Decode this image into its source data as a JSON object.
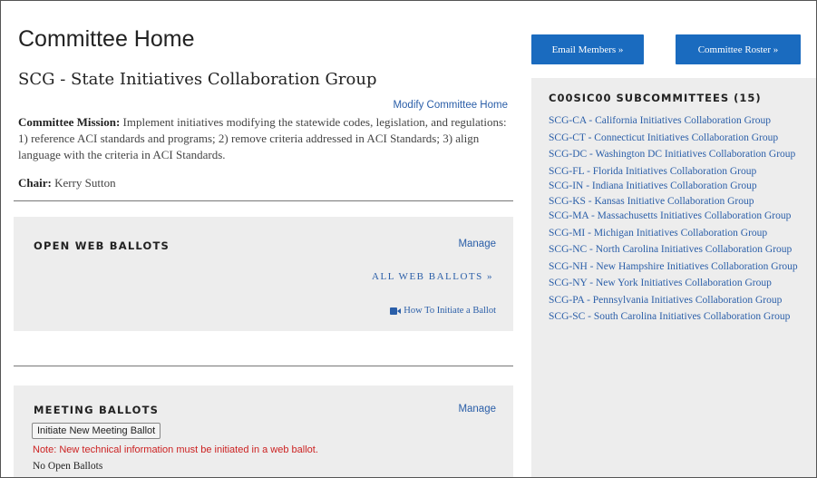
{
  "header": {
    "title": "Committee Home"
  },
  "committee": {
    "name": "SCG - State Initiatives Collaboration Group",
    "modify_link": "Modify Committee Home",
    "mission_label": "Committee Mission:",
    "mission_text": " Implement initiatives modifying the statewide codes, legislation, and regulations: 1) reference ACI standards and programs; 2) remove criteria addressed in ACI Standards; 3) align language with the criteria in ACI Standards.",
    "chair_label": "Chair:",
    "chair_name": " Kerry Sutton"
  },
  "web_ballots": {
    "heading": "OPEN WEB BALLOTS",
    "manage": "Manage",
    "all_link": "ALL WEB BALLOTS »",
    "howto": "How To Initiate a Ballot",
    "howto_icon": "video-icon"
  },
  "meeting_ballots": {
    "heading": "MEETING BALLOTS",
    "manage": "Manage",
    "initiate_button": "Initiate New Meeting Ballot",
    "note": "Note: New technical information must be initiated in a web ballot.",
    "no_ballots": "No Open Ballots"
  },
  "actions": {
    "email_members": "Email Members »",
    "committee_roster": "Committee Roster »"
  },
  "subcommittees": {
    "heading": "C00SIC00 SUBCOMMITTEES (15)",
    "items": [
      "SCG-CA - California Initiatives Collaboration Group",
      "SCG-CT - Connecticut Initiatives Collaboration Group",
      "SCG-DC - Washington DC Initiatives Collaboration Group",
      "SCG-FL - Florida Initiatives Collaboration Group",
      "SCG-IN - Indiana Initiatives Collaboration Group",
      "SCG-KS - Kansas Initiative Collaboration Group",
      "SCG-MA - Massachusetts Initiatives Collaboration Group",
      "SCG-MI - Michigan Initiatives Collaboration Group",
      "SCG-NC - North Carolina Initiatives Collaboration Group",
      "SCG-NH - New Hampshire Initiatives Collaboration Group",
      "SCG-NY - New York Initiatives Collaboration Group",
      "SCG-PA - Pennsylvania Initiatives Collaboration Group",
      "SCG-SC - South Carolina Initiatives Collaboration Group"
    ]
  },
  "colors": {
    "link": "#2a5ea8",
    "button": "#1a6bbf",
    "panel": "#ededed",
    "note": "#cc2222"
  }
}
